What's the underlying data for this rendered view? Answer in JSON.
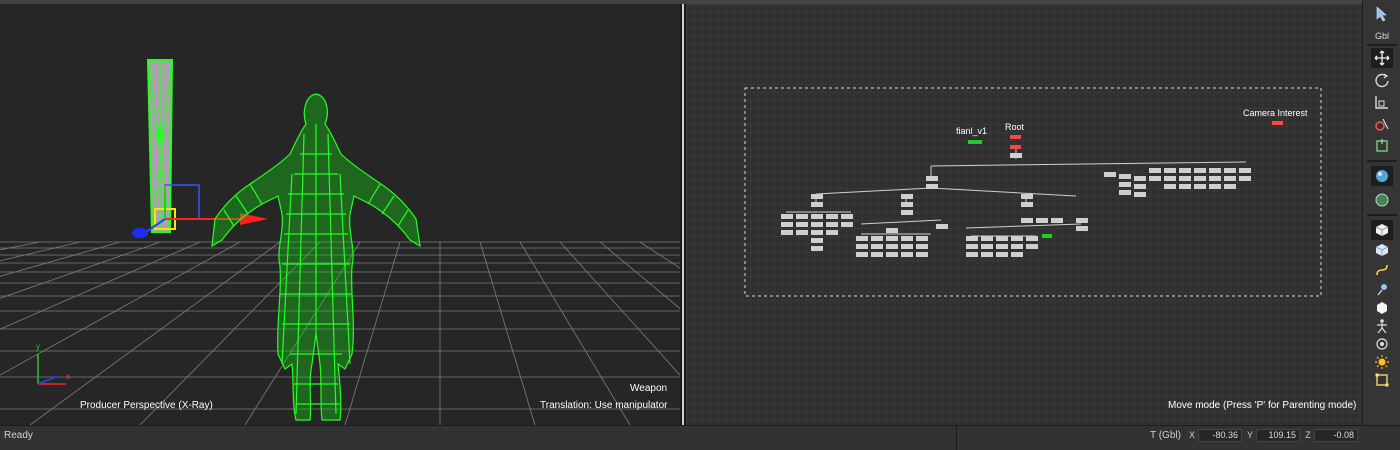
{
  "viewer": {
    "camera_label": "Producer Perspective (X-Ray)",
    "selection_label": "Weapon",
    "mode_hint": "Translation: Use manipulator",
    "axis_y": "y",
    "axis_x": "x"
  },
  "schematic": {
    "nodes": {
      "fianl_v1": "fianl_v1",
      "root": "Root",
      "camera_interest": "Camera Interest"
    },
    "mode_hint": "Move mode (Press 'P' for Parenting mode)"
  },
  "toolbar": {
    "gbl_label": "Gbl",
    "icons": [
      "select-icon",
      "move-icon",
      "rotate-icon",
      "scale-icon",
      "camera-icon",
      "parent-icon",
      "cube-icon",
      "cube-outline-icon",
      "curve-icon",
      "light-icon",
      "sphere-icon",
      "skeleton-icon",
      "marker-icon",
      "sun-icon",
      "frame-icon"
    ]
  },
  "status": {
    "state": "Ready",
    "transform_space": "T (Gbl)",
    "x_label": "X",
    "x_value": "-80.36",
    "y_label": "Y",
    "y_value": "109.15",
    "z_label": "Z",
    "z_value": "-0.08"
  },
  "colors": {
    "wireframe": "#22ff22",
    "selection_red": "#ff3333",
    "node": "#cfcfcf"
  }
}
